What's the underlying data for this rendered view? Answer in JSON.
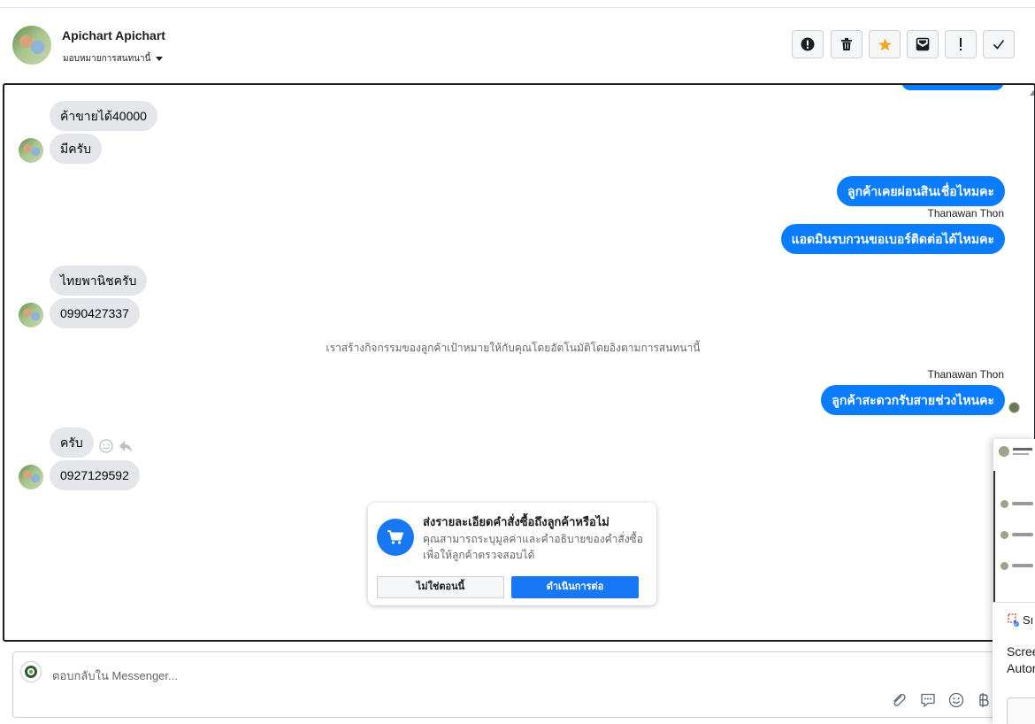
{
  "header": {
    "name": "Apichart Apichart",
    "assign_label": "มอบหมายการสนทนานี้",
    "icons": [
      "exclamation-circle-icon",
      "trash-icon",
      "star-icon",
      "mark-unread-icon",
      "spam-exclamation-icon",
      "checkmark-icon"
    ]
  },
  "messages": {
    "m1": "ค้าขายได้40000",
    "m2": "มีครับ",
    "m3": "ลูกค้าเคยผ่อนสินเชื่อไหมคะ",
    "m3_sender": "Thanawan Thon",
    "m4": "แอดมินรบกวนขอเบอร์ติดต่อได้ไหมคะ",
    "m5": "ไทยพานิชครับ",
    "m6": "0990427337",
    "system_note": "เราสร้างกิจกรรมของลูกค้าเป้าหมายให้กับคุณโดยอัตโนมัติโดยอิงตามการสนทนานี้",
    "m7_sender": "Thanawan Thon",
    "m7": "ลูกค้าสะดวกรับสายช่วงไหนคะ",
    "m8": "ครับ",
    "m9": "0927129592"
  },
  "order_card": {
    "title": "ส่งรายละเอียดคำสั่งซื้อถึงลูกค้าหรือไม่",
    "description": "คุณสามารถระบุมูลค่าและคำอธิบายของคำสั่งซื้อเพื่อให้ลูกค้าตรวจสอบได้",
    "secondary_label": "ไม่ใช่ตอนนี้",
    "primary_label": "ดำเนินการต่อ"
  },
  "composer": {
    "placeholder": "ตอบกลับใน Messenger...",
    "icons": [
      "attachment-icon",
      "saved-reply-icon",
      "emoji-icon",
      "baht-icon"
    ]
  },
  "popup": {
    "label": "Sı",
    "line1": "Scree",
    "line2": "Autor"
  },
  "colors": {
    "outgoing_bubble": "#0a7cff",
    "incoming_bubble": "#e4e6eb",
    "primary_button": "#1877f2",
    "star": "#f5a623"
  }
}
